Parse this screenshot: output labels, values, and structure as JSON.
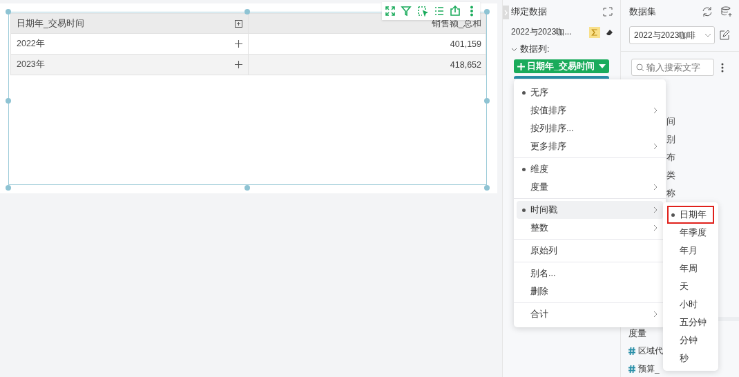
{
  "table": {
    "columns": [
      "日期年_交易时间",
      "销售额_总和"
    ],
    "rows": [
      {
        "cells": [
          "2022年",
          "401,159"
        ]
      },
      {
        "cells": [
          "2023年",
          "418,652"
        ]
      }
    ]
  },
  "binding_panel": {
    "title": "绑定数据",
    "dataset": "2022与2023咖...",
    "section": "数据列:",
    "section_expanded": true,
    "field_chip": "日期年_交易时间"
  },
  "dataset_panel": {
    "title": "数据集",
    "dataset_select": "2022与2023咖啡",
    "search": {
      "placeholder": "输入搜索文字"
    },
    "field_fragments": [
      "间",
      "别",
      "布",
      "类",
      "称"
    ],
    "measures_heading": "度量",
    "measures": [
      "区域代",
      "预算_"
    ]
  },
  "context_menu": {
    "groups": [
      [
        {
          "label": "无序",
          "selected": true,
          "submenu": false,
          "hovered": false
        },
        {
          "label": "按值排序",
          "selected": false,
          "submenu": true,
          "hovered": false
        },
        {
          "label": "按列排序...",
          "selected": false,
          "submenu": false,
          "hovered": false
        },
        {
          "label": "更多排序",
          "selected": false,
          "submenu": true,
          "hovered": false
        }
      ],
      [
        {
          "label": "维度",
          "selected": true,
          "submenu": false,
          "hovered": false
        },
        {
          "label": "度量",
          "selected": false,
          "submenu": true,
          "hovered": false
        }
      ],
      [
        {
          "label": "时间戳",
          "selected": true,
          "submenu": true,
          "hovered": true
        },
        {
          "label": "整数",
          "selected": false,
          "submenu": true,
          "hovered": false
        }
      ],
      [
        {
          "label": "原始列",
          "selected": false,
          "submenu": false,
          "hovered": false
        }
      ],
      [
        {
          "label": "别名...",
          "selected": false,
          "submenu": false,
          "hovered": false
        },
        {
          "label": "删除",
          "selected": false,
          "submenu": false,
          "hovered": false
        }
      ],
      [
        {
          "label": "合计",
          "selected": false,
          "submenu": true,
          "hovered": false
        }
      ]
    ]
  },
  "submenu": {
    "items": [
      {
        "label": "日期年",
        "selected": true,
        "highlighted": true
      },
      {
        "label": "年季度",
        "selected": false,
        "highlighted": false
      },
      {
        "label": "年月",
        "selected": false,
        "highlighted": false
      },
      {
        "label": "年周",
        "selected": false,
        "highlighted": false
      },
      {
        "label": "天",
        "selected": false,
        "highlighted": false
      },
      {
        "label": "小时",
        "selected": false,
        "highlighted": false
      },
      {
        "label": "五分钟",
        "selected": false,
        "highlighted": false
      },
      {
        "label": "分钟",
        "selected": false,
        "highlighted": false
      },
      {
        "label": "秒",
        "selected": false,
        "highlighted": false
      }
    ]
  }
}
